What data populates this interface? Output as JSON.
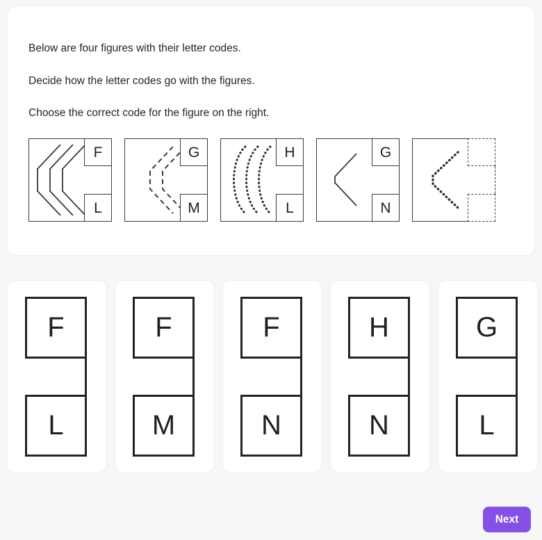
{
  "instructions": [
    "Below are four figures with their letter codes.",
    "Decide how the letter codes go with the figures.",
    "Choose the correct code for the figure on the right."
  ],
  "figures": [
    {
      "id": "figure-1",
      "shape": "chevron",
      "count": 3,
      "stroke": "solid",
      "top_letter": "F",
      "bottom_letter": "L",
      "is_question": false
    },
    {
      "id": "figure-2",
      "shape": "chevron",
      "count": 2,
      "stroke": "dashed",
      "top_letter": "G",
      "bottom_letter": "M",
      "is_question": false
    },
    {
      "id": "figure-3",
      "shape": "arc",
      "count": 3,
      "stroke": "dotted",
      "top_letter": "H",
      "bottom_letter": "L",
      "is_question": false
    },
    {
      "id": "figure-4",
      "shape": "chevron",
      "count": 1,
      "stroke": "solid",
      "top_letter": "G",
      "bottom_letter": "N",
      "is_question": false
    },
    {
      "id": "figure-5-question",
      "shape": "chevron",
      "count": 1,
      "stroke": "dotted",
      "top_letter": "",
      "bottom_letter": "",
      "is_question": true
    }
  ],
  "options": [
    {
      "id": "option-a",
      "top_letter": "F",
      "bottom_letter": "L"
    },
    {
      "id": "option-b",
      "top_letter": "F",
      "bottom_letter": "M"
    },
    {
      "id": "option-c",
      "top_letter": "F",
      "bottom_letter": "N"
    },
    {
      "id": "option-d",
      "top_letter": "H",
      "bottom_letter": "N"
    },
    {
      "id": "option-e",
      "top_letter": "G",
      "bottom_letter": "L"
    }
  ],
  "footer": {
    "next_label": "Next"
  },
  "colors": {
    "page_background": "#f7f7fa",
    "card_background": "#ffffff",
    "card_border": "#ececf3",
    "stroke": "#3a3a3a",
    "option_stroke": "#232323",
    "text": "#23252b",
    "accent": "#8550e8"
  }
}
